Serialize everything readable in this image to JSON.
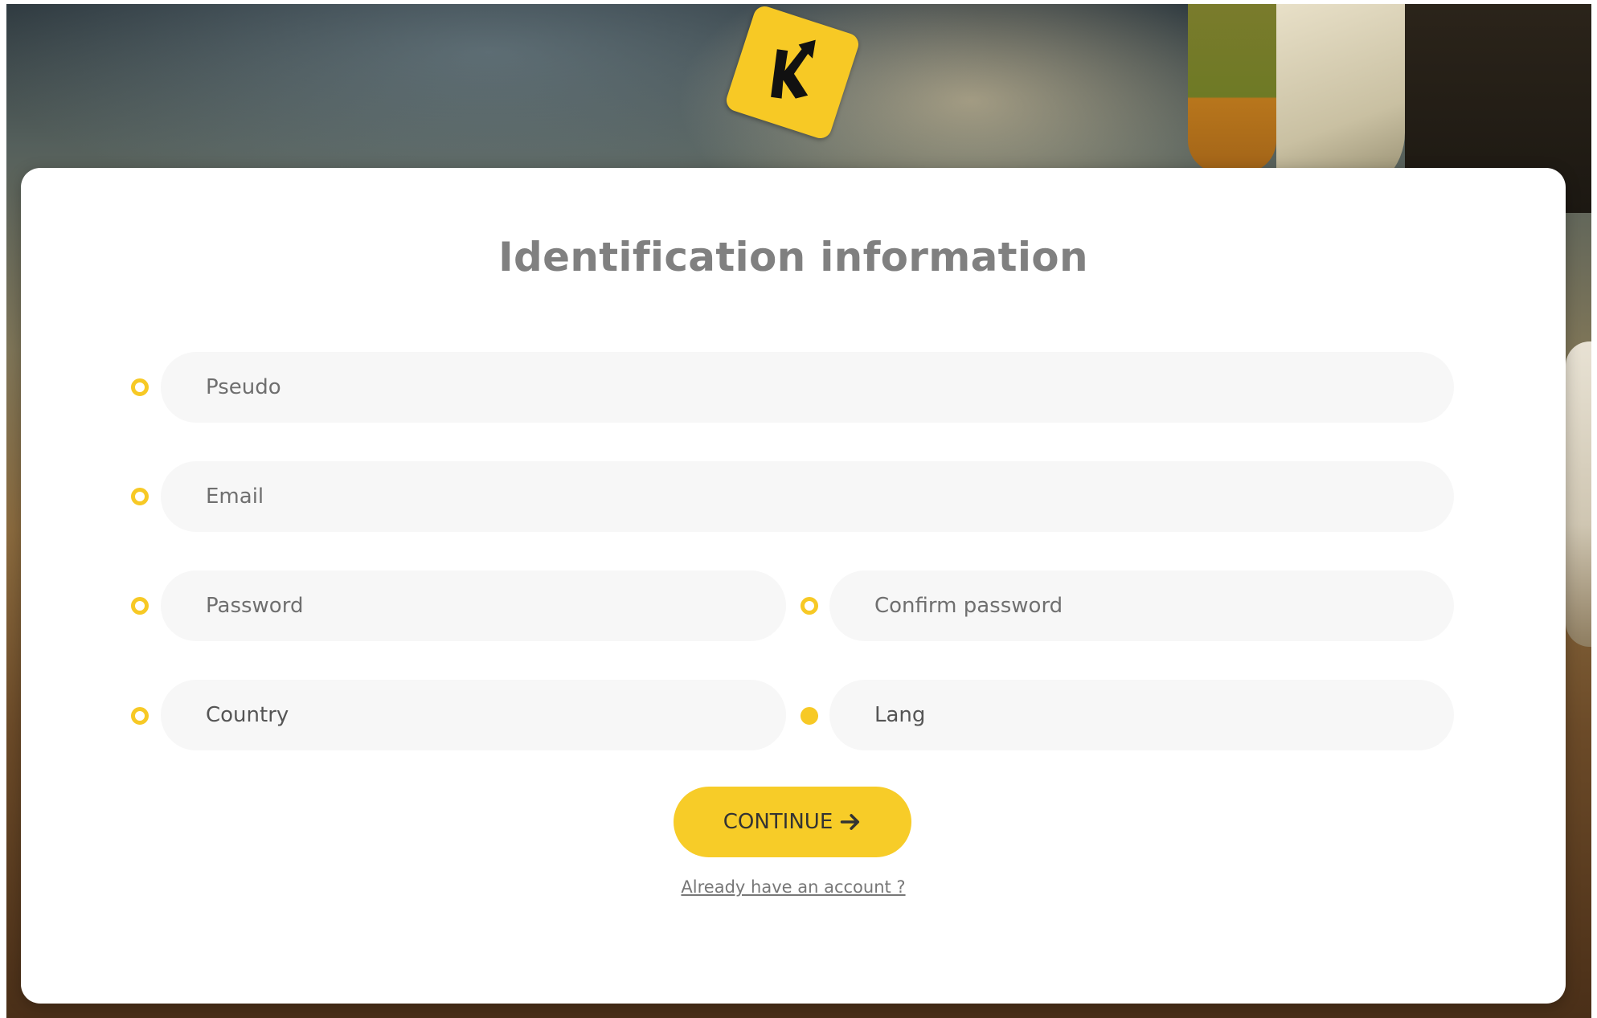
{
  "brand": {
    "logo_icon": "k-arrow-logo-icon",
    "accent_color": "#f7c925"
  },
  "form": {
    "title": "Identification information",
    "fields": {
      "pseudo": {
        "placeholder": "Pseudo",
        "required": true
      },
      "email": {
        "placeholder": "Email",
        "required": true
      },
      "password": {
        "placeholder": "Password",
        "required": true
      },
      "confirm_password": {
        "placeholder": "Confirm password",
        "required": true
      },
      "country": {
        "value": "Country",
        "required": true
      },
      "lang": {
        "value": "Lang",
        "required": true,
        "filled": true
      }
    },
    "continue_label": "CONTINUE",
    "continue_icon": "arrow-right-icon",
    "login_link": "Already have an account ?"
  }
}
